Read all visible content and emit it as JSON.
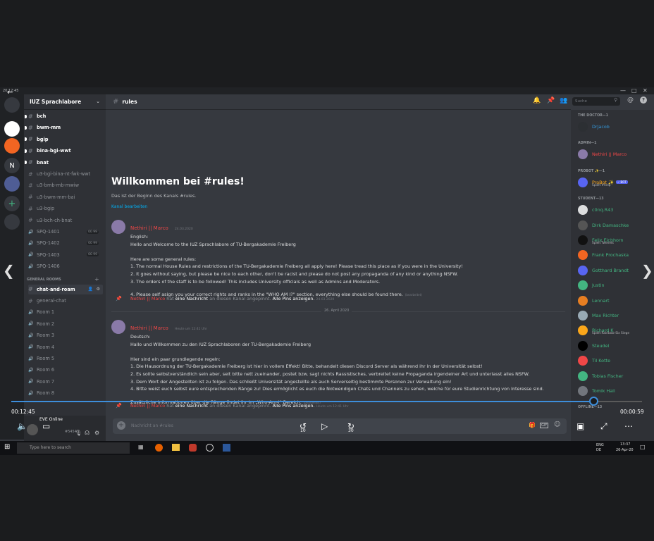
{
  "window": {
    "clock": "20:12:45"
  },
  "server": {
    "name": "IUZ Sprachlabore"
  },
  "rail": [
    {
      "label": "",
      "icon": "discord-icon"
    },
    {
      "label": "",
      "icon": "server-iuz-icon"
    },
    {
      "label": "",
      "icon": "server-orange-icon"
    },
    {
      "label": "N",
      "icon": "server-n-icon"
    },
    {
      "label": "",
      "icon": "server-art-icon"
    },
    {
      "label": "+",
      "icon": "add-server-icon"
    },
    {
      "label": "",
      "icon": "explore-icon"
    }
  ],
  "channels": [
    {
      "name": "bch",
      "bold": true
    },
    {
      "name": "bwm-mm",
      "bold": true
    },
    {
      "name": "bgip",
      "bold": true
    },
    {
      "name": "bina-bgi-wwt",
      "bold": true
    },
    {
      "name": "bnat",
      "bold": true
    },
    {
      "name": "u3-bgi-bina-nt-fwk-wwt",
      "bold": false
    },
    {
      "name": "u3-bmb-mb-mwiw",
      "bold": false
    },
    {
      "name": "u3-bwm-mm-bai",
      "bold": false
    },
    {
      "name": "u3-bgip",
      "bold": false
    },
    {
      "name": "u3-bch-ch-bnat",
      "bold": false
    }
  ],
  "voice_spq": [
    {
      "name": "SPQ-1401",
      "pill": "00 99"
    },
    {
      "name": "SPQ-1402",
      "pill": "00 99"
    },
    {
      "name": "SPQ-1403",
      "pill": "00 99"
    },
    {
      "name": "SPQ-1406",
      "pill": ""
    }
  ],
  "general_rooms": {
    "category": "GENERAL ROOMS",
    "text": [
      "chat-and-roam",
      "general-chat"
    ],
    "voice": [
      "Room 1",
      "Room 2",
      "Room 3",
      "Room 4",
      "Room 5",
      "Room 6",
      "Room 7",
      "Room 8"
    ]
  },
  "user": {
    "name": "EVE Online",
    "tag": "#5454"
  },
  "header": {
    "channel": "rules",
    "search_placeholder": "Suche"
  },
  "welcome": {
    "title": "Willkommen bei #rules!",
    "subtitle": "Das ist der Beginn des Kanals #rules.",
    "edit_link": "Kanal bearbeiten"
  },
  "messages": [
    {
      "author": "Nethiri || Marco",
      "time": "24.03.2020",
      "lines": [
        "English:",
        "Hello and Welcome to the IUZ Sprachlabore of TU-Bergakademie Freiberg",
        "",
        "Here are some general rules:",
        "1. The normal House Rules and restrictions of the TU-Bergakademie Freiberg all apply here! Please tread this place as if you were in the University!",
        "2. It goes without saying, but please be nice to each other, don't be racist and please do not post any propaganda of any kind or anything NSFW.",
        "3. The orders of the staff is to be followed! This includes University officials as well as Admins and Moderators.",
        "4. Please self asign you your correct rights and ranks in the \"WHO AM I?\" section, everything else should be found there."
      ],
      "edited": "(bearbeitet)"
    }
  ],
  "pin1": {
    "author": "Nethiri || Marco",
    "mid": "hat",
    "bold1": "eine Nachricht",
    "rest": "an diesen Kanal angepinnt.",
    "bold2": "Alle Pins anzeigen.",
    "time": "24.03.2020"
  },
  "divider": "26. April 2020",
  "message2": {
    "author": "Nethiri || Marco",
    "time": "Heute um 12:41 Uhr",
    "lines": [
      "Deutsch:",
      "Hallo und Willkommen zu den IUZ Sprachlaboren der TU-Bergakademie Freiberg",
      "",
      "Hier sind ein paar grundlegende regeln:",
      "1. Die Hausordnung der TU-Bergakademie Freiberg ist hier in vollem Effekt! Bitte, behandelt diesen Discord Server als während ihr in der Universität selbst!",
      "2. Es sollte selbstverständlich sein aber, seit bitte nett zueinander, postet bzw. sagt nichts Rassistisches, verbreitet keine Propaganda irgendeiner Art und unterlasst alles NSFW.",
      "3. Dem Wort der Angestellten ist zu folgen. Das schließt Universität angestellte als auch Serverseitig bestimmte Personen zur Verwaltung ein!",
      "4. Bitte weist euch selbst eure entsprechenden Ränge zu! Dies ermöglicht es euch die Notwendigen Chats und Channels zu sehen, welche für eure Studienrichtung von Interesse sind.",
      "Zusätzliche Informationen über die Ränge findet ihr im „Who-Am-I“ Bereich."
    ],
    "edited": "(bearbeitet)"
  },
  "pin2": {
    "author": "Nethiri || Marco",
    "mid": "hat",
    "bold1": "eine Nachricht",
    "rest": "an diesen Kanal angepinnt.",
    "bold2": "Alle Pins anzeigen.",
    "time": "Heute um 12:41 Uhr"
  },
  "composer": {
    "placeholder": "Nachricht an #rules"
  },
  "members": {
    "groups": [
      {
        "title": "THE DOCTOR—1",
        "items": [
          {
            "name": "DrJacob",
            "color": "#3498db",
            "sub": "",
            "avatar": "#2c2f33"
          }
        ]
      },
      {
        "title": "ADMIN—1",
        "items": [
          {
            "name": "Nethiri || Marco",
            "color": "#f04747",
            "sub": "",
            "avatar": "#8a7aa8"
          }
        ]
      },
      {
        "title": "PROBOT ✨—1",
        "items": [
          {
            "name": "ProBot ✨",
            "color": "#faa61a",
            "sub": "Spielt #help",
            "avatar": "#5865f2",
            "bot": "✓ BOT"
          }
        ]
      },
      {
        "title": "STUDENT—13",
        "items": [
          {
            "name": "c0nq.R43",
            "color": "#43b581",
            "sub": "",
            "avatar": "#dcddde"
          },
          {
            "name": "Dirk Damaschke",
            "color": "#43b581",
            "sub": "",
            "avatar": "#555"
          },
          {
            "name": "Felix Eichhorn",
            "color": "#43b581",
            "sub": "Spielt Twenets",
            "avatar": "#111"
          },
          {
            "name": "Frank Prochaska",
            "color": "#43b581",
            "sub": "",
            "avatar": "#f26522"
          },
          {
            "name": "Gotthard Brandt",
            "color": "#43b581",
            "sub": "",
            "avatar": "#5865f2"
          },
          {
            "name": "Justin",
            "color": "#43b581",
            "sub": "",
            "avatar": "#43b581"
          },
          {
            "name": "Lennart",
            "color": "#43b581",
            "sub": "",
            "avatar": "#e67e22"
          },
          {
            "name": "Max Richter",
            "color": "#43b581",
            "sub": "",
            "avatar": "#99aab5"
          },
          {
            "name": "Richard K",
            "color": "#43b581",
            "sub": "Spielt Rainbow Six Siege",
            "avatar": "#faa61a"
          },
          {
            "name": "Steudel",
            "color": "#43b581",
            "sub": "",
            "avatar": "#000"
          },
          {
            "name": "Til Kotte",
            "color": "#43b581",
            "sub": "",
            "avatar": "#f04747"
          },
          {
            "name": "Tobias Fischer",
            "color": "#43b581",
            "sub": "",
            "avatar": "#43b581"
          },
          {
            "name": "Tomik Hall",
            "color": "#43b581",
            "sub": "",
            "avatar": "#72767d"
          }
        ]
      },
      {
        "title": "OFFLINE—13",
        "items": []
      }
    ]
  },
  "video": {
    "elapsed": "00:12:45",
    "remaining": "00:00:59",
    "progress": 0.923,
    "rewind": "10",
    "forward": "30"
  },
  "taskbar": {
    "search": "Type here to search",
    "lang": "ENG",
    "region": "DE",
    "time": "13:37",
    "date": "26-Apr-20"
  }
}
